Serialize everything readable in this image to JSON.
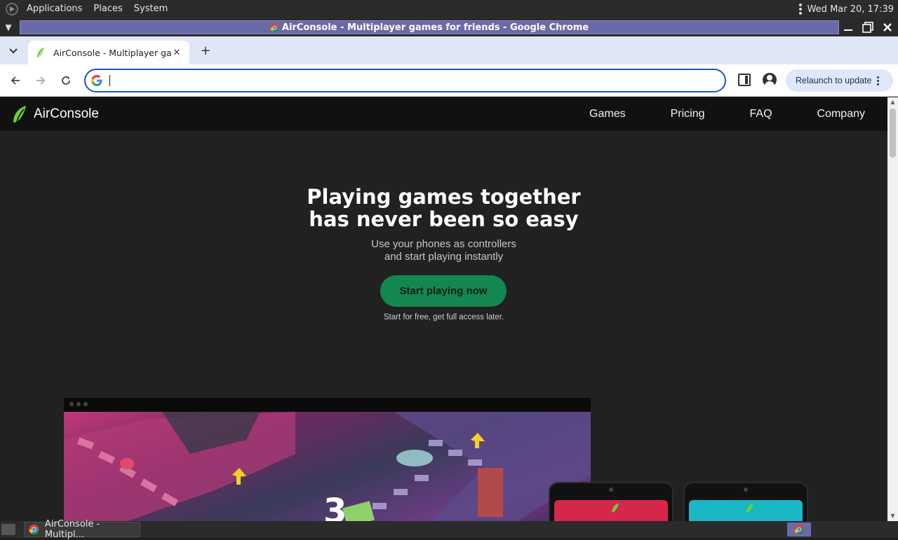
{
  "panel": {
    "menu": [
      "Applications",
      "Places",
      "System"
    ],
    "clock": "Wed Mar 20, 17:39"
  },
  "window": {
    "title": "AirConsole - Multiplayer games for friends - Google Chrome"
  },
  "browser": {
    "tab_title": "AirConsole - Multiplayer gam",
    "omnibox_value": "",
    "relaunch_label": "Relaunch to update"
  },
  "site": {
    "brand": "AirConsole",
    "nav": [
      "Games",
      "Pricing",
      "FAQ",
      "Company"
    ],
    "hero_title_line1": "Playing games together",
    "hero_title_line2": "has never been so easy",
    "hero_sub_line1": "Use your phones as controllers",
    "hero_sub_line2": "and start playing instantly",
    "cta_label": "Start playing now",
    "cta_note": "Start for free, get full access later."
  },
  "taskbar": {
    "item_label": "AirConsole - Multipl..."
  },
  "colors": {
    "accent_green": "#14864f",
    "omnibox_focus": "#1a56c6",
    "title_strip": "#6b6aa8"
  }
}
